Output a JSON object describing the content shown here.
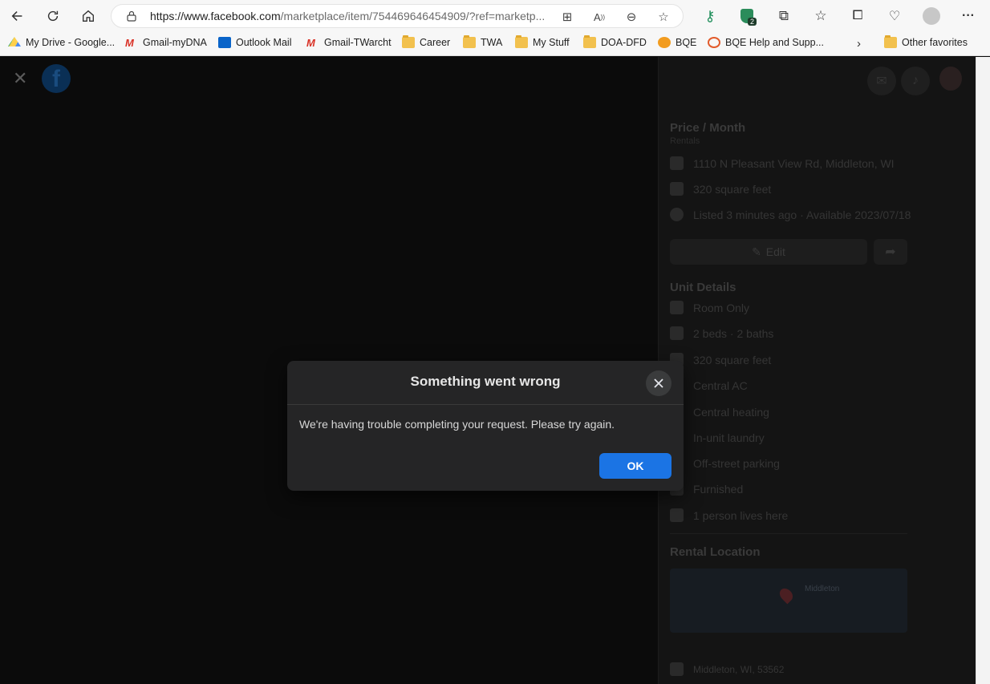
{
  "browser": {
    "url_main": "https://www.facebook.com",
    "url_rest": "/marketplace/item/754469646454909/?ref=marketp...",
    "bookmarks": [
      {
        "label": "My Drive - Google...",
        "icon": "google-drive-icon"
      },
      {
        "label": "Gmail-myDNA",
        "icon": "gmail-icon"
      },
      {
        "label": "Outlook Mail",
        "icon": "outlook-icon"
      },
      {
        "label": "Gmail-TWarcht",
        "icon": "gmail-icon"
      },
      {
        "label": "Career",
        "icon": "folder-icon"
      },
      {
        "label": "TWA",
        "icon": "folder-icon"
      },
      {
        "label": "My Stuff",
        "icon": "folder-icon"
      },
      {
        "label": "DOA-DFD",
        "icon": "folder-icon"
      },
      {
        "label": "BQE",
        "icon": "bqe-icon"
      },
      {
        "label": "BQE Help and Supp...",
        "icon": "bqe-help-icon"
      },
      {
        "label": "Other favorites",
        "icon": "folder-icon"
      }
    ],
    "extension_badge": "2"
  },
  "listing": {
    "price_label": "Price / Month",
    "category": "Rentals",
    "address": "1110 N Pleasant View Rd, Middleton, WI",
    "size": "320 square feet",
    "listed": "Listed 3 minutes ago · Available 2023/07/18",
    "edit_label": "Edit",
    "unit_details_title": "Unit Details",
    "details": [
      "Room Only",
      "2 beds · 2 baths",
      "320 square feet",
      "Central AC",
      "Central heating",
      "In-unit laundry",
      "Off-street parking",
      "Furnished",
      "1 person lives here"
    ],
    "rental_location_title": "Rental Location",
    "map_town": "Middleton",
    "location_line": "Middleton, WI, 53562"
  },
  "dialog": {
    "title": "Something went wrong",
    "message": "We're having trouble completing your request. Please try again.",
    "ok_label": "OK"
  },
  "colors": {
    "primary_button": "#1b74e4",
    "dialog_bg": "#252526"
  }
}
